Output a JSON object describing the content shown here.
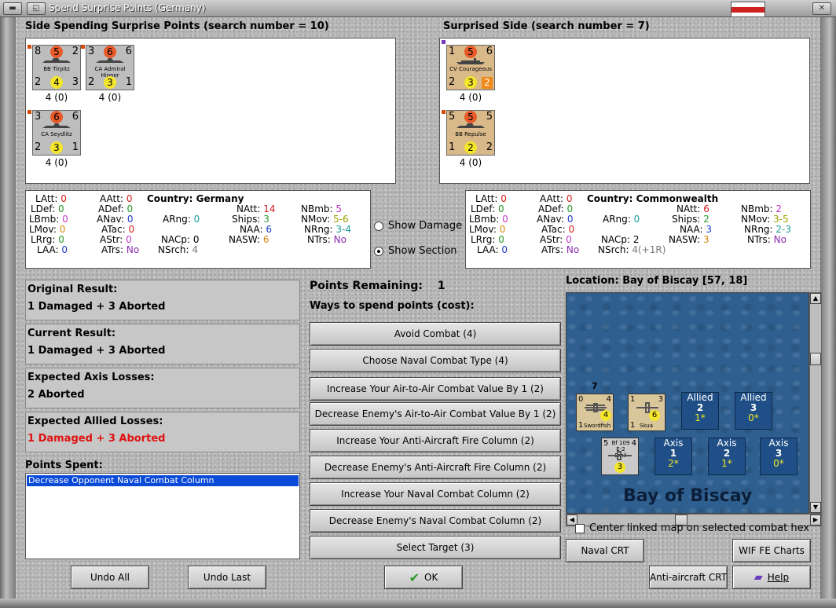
{
  "window": {
    "title": "Spend Surprise Points (Germany)"
  },
  "spending_side": {
    "header": "Side Spending Surprise Points (search number = 10)",
    "units": [
      {
        "tl": "8",
        "tc": "5",
        "tr": "2",
        "name": "BB Tirpitz",
        "bl": "2",
        "bc": "4",
        "br": "3",
        "sub": "4 (0)"
      },
      {
        "tl": "3",
        "tc": "6",
        "tr": "6",
        "name": "CA Admiral Hipper",
        "bl": "2",
        "bc": "3",
        "br": "1",
        "sub": "4 (0)"
      },
      {
        "tl": "3",
        "tc": "6",
        "tr": "6",
        "name": "CA Seydlitz",
        "bl": "2",
        "bc": "3",
        "br": "1",
        "sub": "4 (0)"
      }
    ]
  },
  "surprised_side": {
    "header": "Surprised Side (search number = 7)",
    "units": [
      {
        "tl": "1",
        "tc": "5",
        "tr": "6",
        "name": "CV Courageous",
        "bl": "2",
        "bc": "3",
        "br": "2",
        "sub": "4 (0)"
      },
      {
        "tl": "5",
        "tc": "5",
        "tr": "5",
        "name": "BB Repulse",
        "bl": "1",
        "bc": "2",
        "br": "2",
        "sub": "4 (0)"
      }
    ]
  },
  "stats_left": {
    "country": "Country: Germany",
    "latt": "0",
    "ldef": "0",
    "lbmb": "0",
    "lmov": "0",
    "lrng": "0",
    "laa": "0",
    "aatt": "0",
    "adef": "0",
    "anav": "0",
    "atac": "0",
    "astr": "0",
    "atrs": "No",
    "arng": "0",
    "nacp": "0",
    "nsrch": "4",
    "natt": "14",
    "ships": "3",
    "naa": "6",
    "nasw": "6",
    "nbmb": "5",
    "nmov": "5-6",
    "nrng": "3-4",
    "ntrs": "No"
  },
  "stats_right": {
    "country": "Country: Commonwealth",
    "latt": "0",
    "ldef": "0",
    "lbmb": "0",
    "lmov": "0",
    "lrng": "0",
    "laa": "0",
    "aatt": "0",
    "adef": "0",
    "anav": "0",
    "atac": "0",
    "astr": "0",
    "atrs": "No",
    "arng": "0",
    "nacp": "2",
    "nsrch": "4(+1R)",
    "natt": "6",
    "ships": "2",
    "naa": "3",
    "nasw": "3",
    "nbmb": "2",
    "nmov": "3-5",
    "nrng": "2-3",
    "ntrs": "No"
  },
  "labels": {
    "latt": "LAtt:",
    "ldef": "LDef:",
    "lbmb": "LBmb:",
    "lmov": "LMov:",
    "lrng": "LRrg:",
    "laa": "LAA:",
    "aatt": "AAtt:",
    "adef": "ADef:",
    "anav": "ANav:",
    "atac": "ATac:",
    "astr": "AStr:",
    "atrs": "ATrs:",
    "arng": "ARng:",
    "nacp": "NACp:",
    "nsrch": "NSrch:",
    "natt": "NAtt:",
    "ships": "Ships:",
    "naa": "NAA:",
    "nasw": "NASW:",
    "nbmb": "NBmb:",
    "nmov": "NMov:",
    "nrng": "NRng:",
    "ntrs": "NTrs:"
  },
  "options": {
    "show_damage": "Show Damage",
    "show_section": "Show Section"
  },
  "results": {
    "original_title": "Original Result:",
    "original": "1 Damaged + 3 Aborted",
    "current_title": "Current Result:",
    "current": "1 Damaged + 3 Aborted",
    "axis_title": "Expected Axis Losses:",
    "axis": "2 Aborted",
    "allied_title": "Expected Allied Losses:",
    "allied": "1 Damaged + 3 Aborted"
  },
  "points_spent": {
    "title": "Points Spent:",
    "items": [
      "Decrease Opponent Naval Combat Column"
    ]
  },
  "spend": {
    "remaining_label": "Points Remaining:",
    "remaining": "1",
    "ways_label": "Ways to spend points (cost):",
    "buttons": [
      "Avoid Combat (4)",
      "Choose Naval Combat Type (4)",
      "Increase Your Air-to-Air Combat Value By 1 (2)",
      "Decrease Enemy's Air-to-Air Combat Value By 1 (2)",
      "Increase Your Anti-Aircraft Fire Column (2)",
      "Decrease Enemy's Anti-Aircraft Fire Column (2)",
      "Increase Your Naval Combat Column (2)",
      "Decrease Enemy's Naval Combat Column (2)",
      "Select Target (3)"
    ]
  },
  "map": {
    "location": "Location: Bay of Biscay [57, 18]",
    "sea_label": "Bay of Biscay",
    "stack_count": "7",
    "air_units": [
      {
        "tl": "0",
        "tr": "4",
        "bl": "1",
        "c": "4",
        "name": "Swordfish"
      },
      {
        "tl": "1",
        "tr": "3",
        "bl": "1",
        "c": "6",
        "name": "Skua"
      },
      {
        "tl": "5",
        "tr": "4",
        "bl": "",
        "c": "3",
        "name": "Bf 109 E-2 Emil"
      }
    ],
    "hexes": [
      {
        "side": "Allied",
        "num": "2",
        "sub": "1*"
      },
      {
        "side": "Allied",
        "num": "3",
        "sub": "0*"
      },
      {
        "side": "Axis",
        "num": "1",
        "sub": "2*"
      },
      {
        "side": "Axis",
        "num": "2",
        "sub": "1*"
      },
      {
        "side": "Axis",
        "num": "3",
        "sub": "0*"
      }
    ],
    "center_check": "Center linked map on selected combat hex"
  },
  "footer": {
    "undo_all": "Undo All",
    "undo_last": "Undo Last",
    "ok": "OK",
    "naval_crt": "Naval CRT",
    "wif_fe": "WIF FE Charts",
    "aa_crt": "Anti-aircraft CRT",
    "help": "Help"
  }
}
